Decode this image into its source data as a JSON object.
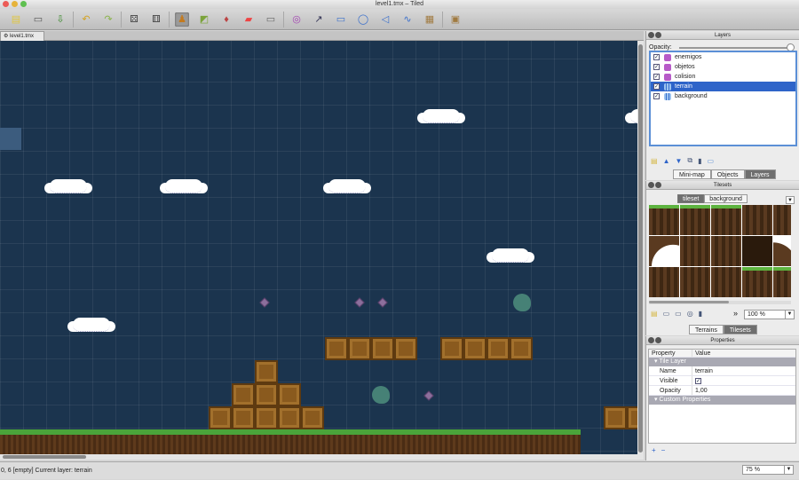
{
  "window": {
    "title": "level1.tmx – Tiled"
  },
  "toolbar": {
    "icons": [
      "new-file",
      "open-file",
      "save-file",
      "undo",
      "redo",
      "random-mode",
      "stamp-brush",
      "terrain-brush",
      "bucket-fill",
      "eraser",
      "rect-select",
      "magic-wand",
      "insert-rect",
      "insert-ellipse",
      "insert-polygon",
      "insert-polyline",
      "insert-tile",
      "insert-image"
    ]
  },
  "document_tab": {
    "label": "level1.tmx"
  },
  "map": {
    "background": "#1b344e",
    "clouds": 8,
    "objects": [
      "gem",
      "gem",
      "gem",
      "gem",
      "ghost",
      "ghost"
    ]
  },
  "layers_panel": {
    "title": "Layers",
    "opacity_label": "Opacity:",
    "items": [
      {
        "name": "enemigos",
        "type": "object",
        "visible": true
      },
      {
        "name": "objetos",
        "type": "object",
        "visible": true
      },
      {
        "name": "colision",
        "type": "object",
        "visible": true
      },
      {
        "name": "terrain",
        "type": "tile",
        "visible": true,
        "selected": true
      },
      {
        "name": "background",
        "type": "tile",
        "visible": true
      }
    ],
    "tabs": [
      "Mini-map",
      "Objects",
      "Layers"
    ],
    "active_tab": "Layers"
  },
  "tilesets_panel": {
    "title": "Tilesets",
    "tabs": [
      "tileset",
      "background"
    ],
    "active_tab": "tileset",
    "zoom": "100 %",
    "bottom_tabs": [
      "Terrains",
      "Tilesets"
    ],
    "active_bottom_tab": "Tilesets"
  },
  "properties_panel": {
    "title": "Properties",
    "header": {
      "property": "Property",
      "value": "Value"
    },
    "group_tile_layer": "Tile Layer",
    "rows": [
      {
        "name": "Name",
        "value": "terrain"
      },
      {
        "name": "Visible",
        "value": "✓"
      },
      {
        "name": "Opacity",
        "value": "1,00"
      }
    ],
    "group_custom": "Custom Properties"
  },
  "statusbar": {
    "text": "0, 6 [empty]  Current layer: terrain",
    "zoom": "75 %"
  },
  "colors": {
    "selection": "#2e64c9",
    "map_bg": "#1b344e",
    "grass": "#4aa43a"
  }
}
